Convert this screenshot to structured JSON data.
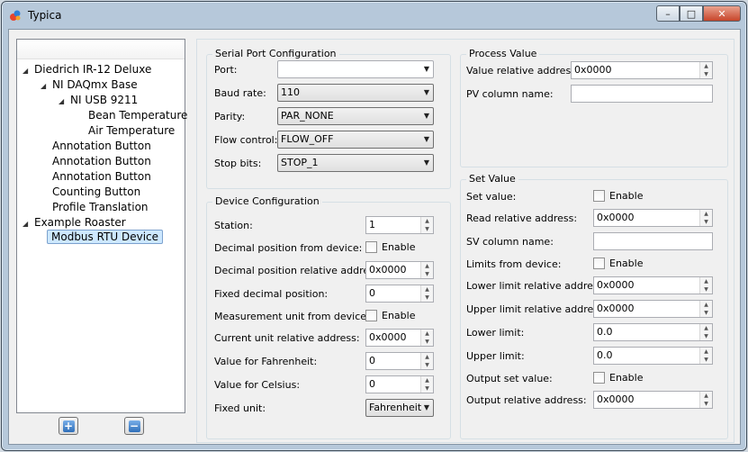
{
  "window": {
    "title": "Typica"
  },
  "tree": {
    "items": [
      {
        "label": "Diedrich IR-12 Deluxe",
        "level": 0,
        "expanded": true
      },
      {
        "label": "NI DAQmx Base",
        "level": 1,
        "expanded": true
      },
      {
        "label": "NI USB 9211",
        "level": 2,
        "expanded": true
      },
      {
        "label": "Bean Temperature",
        "level": 3
      },
      {
        "label": "Air Temperature",
        "level": 3
      },
      {
        "label": "Annotation Button",
        "level": 1
      },
      {
        "label": "Annotation Button",
        "level": 1
      },
      {
        "label": "Annotation Button",
        "level": 1
      },
      {
        "label": "Counting Button",
        "level": 1
      },
      {
        "label": "Profile Translation",
        "level": 1
      },
      {
        "label": "Example Roaster",
        "level": 0,
        "expanded": true
      },
      {
        "label": "Modbus RTU Device",
        "level": 1,
        "selected": true
      }
    ],
    "add_symbol": "+",
    "remove_symbol": "−"
  },
  "serial": {
    "title": "Serial Port Configuration",
    "port_label": "Port:",
    "port_value": "",
    "baud_label": "Baud rate:",
    "baud_value": "110",
    "parity_label": "Parity:",
    "parity_value": "PAR_NONE",
    "flow_label": "Flow control:",
    "flow_value": "FLOW_OFF",
    "stop_label": "Stop bits:",
    "stop_value": "STOP_1"
  },
  "device": {
    "title": "Device Configuration",
    "station_label": "Station:",
    "station_value": "1",
    "decpos_label": "Decimal position from device:",
    "decpos_check": "Enable",
    "decaddr_label": "Decimal position relative address:",
    "decaddr_value": "0x0000",
    "fixeddec_label": "Fixed decimal position:",
    "fixeddec_value": "0",
    "unitdev_label": "Measurement unit from device:",
    "unitdev_check": "Enable",
    "unitaddr_label": "Current unit relative address:",
    "unitaddr_value": "0x0000",
    "fahr_label": "Value for Fahrenheit:",
    "fahr_value": "0",
    "cels_label": "Value for Celsius:",
    "cels_value": "0",
    "fixedunit_label": "Fixed unit:",
    "fixedunit_value": "Fahrenheit"
  },
  "pv": {
    "title": "Process Value",
    "addr_label": "Value relative address:",
    "addr_value": "0x0000",
    "col_label": "PV column name:",
    "col_value": ""
  },
  "sv": {
    "title": "Set Value",
    "setval_label": "Set value:",
    "setval_check": "Enable",
    "readaddr_label": "Read relative address:",
    "readaddr_value": "0x0000",
    "col_label": "SV column name:",
    "col_value": "",
    "limits_label": "Limits from device:",
    "limits_check": "Enable",
    "lowaddr_label": "Lower limit relative address:",
    "lowaddr_value": "0x0000",
    "upaddr_label": "Upper limit relative address:",
    "upaddr_value": "0x0000",
    "low_label": "Lower limit:",
    "low_value": "0.0",
    "up_label": "Upper limit:",
    "up_value": "0.0",
    "outset_label": "Output set value:",
    "outset_check": "Enable",
    "outaddr_label": "Output relative address:",
    "outaddr_value": "0x0000"
  }
}
